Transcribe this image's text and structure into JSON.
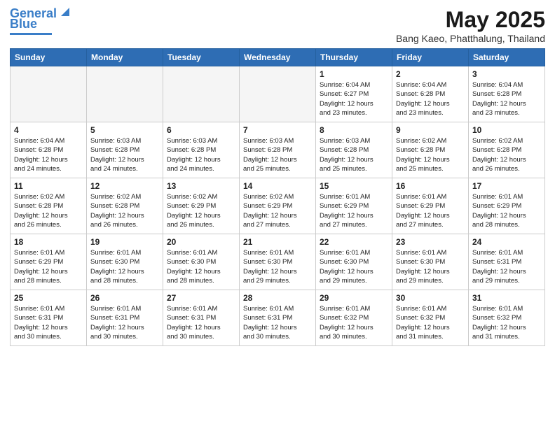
{
  "header": {
    "logo_line1": "General",
    "logo_line2": "Blue",
    "title": "May 2025",
    "subtitle": "Bang Kaeo, Phatthalung, Thailand"
  },
  "calendar": {
    "weekdays": [
      "Sunday",
      "Monday",
      "Tuesday",
      "Wednesday",
      "Thursday",
      "Friday",
      "Saturday"
    ],
    "weeks": [
      [
        {
          "day": "",
          "empty": true
        },
        {
          "day": "",
          "empty": true
        },
        {
          "day": "",
          "empty": true
        },
        {
          "day": "",
          "empty": true
        },
        {
          "day": "1",
          "info": "Sunrise: 6:04 AM\nSunset: 6:27 PM\nDaylight: 12 hours\nand 23 minutes."
        },
        {
          "day": "2",
          "info": "Sunrise: 6:04 AM\nSunset: 6:28 PM\nDaylight: 12 hours\nand 23 minutes."
        },
        {
          "day": "3",
          "info": "Sunrise: 6:04 AM\nSunset: 6:28 PM\nDaylight: 12 hours\nand 23 minutes."
        }
      ],
      [
        {
          "day": "4",
          "info": "Sunrise: 6:04 AM\nSunset: 6:28 PM\nDaylight: 12 hours\nand 24 minutes."
        },
        {
          "day": "5",
          "info": "Sunrise: 6:03 AM\nSunset: 6:28 PM\nDaylight: 12 hours\nand 24 minutes."
        },
        {
          "day": "6",
          "info": "Sunrise: 6:03 AM\nSunset: 6:28 PM\nDaylight: 12 hours\nand 24 minutes."
        },
        {
          "day": "7",
          "info": "Sunrise: 6:03 AM\nSunset: 6:28 PM\nDaylight: 12 hours\nand 25 minutes."
        },
        {
          "day": "8",
          "info": "Sunrise: 6:03 AM\nSunset: 6:28 PM\nDaylight: 12 hours\nand 25 minutes."
        },
        {
          "day": "9",
          "info": "Sunrise: 6:02 AM\nSunset: 6:28 PM\nDaylight: 12 hours\nand 25 minutes."
        },
        {
          "day": "10",
          "info": "Sunrise: 6:02 AM\nSunset: 6:28 PM\nDaylight: 12 hours\nand 26 minutes."
        }
      ],
      [
        {
          "day": "11",
          "info": "Sunrise: 6:02 AM\nSunset: 6:28 PM\nDaylight: 12 hours\nand 26 minutes."
        },
        {
          "day": "12",
          "info": "Sunrise: 6:02 AM\nSunset: 6:28 PM\nDaylight: 12 hours\nand 26 minutes."
        },
        {
          "day": "13",
          "info": "Sunrise: 6:02 AM\nSunset: 6:29 PM\nDaylight: 12 hours\nand 26 minutes."
        },
        {
          "day": "14",
          "info": "Sunrise: 6:02 AM\nSunset: 6:29 PM\nDaylight: 12 hours\nand 27 minutes."
        },
        {
          "day": "15",
          "info": "Sunrise: 6:01 AM\nSunset: 6:29 PM\nDaylight: 12 hours\nand 27 minutes."
        },
        {
          "day": "16",
          "info": "Sunrise: 6:01 AM\nSunset: 6:29 PM\nDaylight: 12 hours\nand 27 minutes."
        },
        {
          "day": "17",
          "info": "Sunrise: 6:01 AM\nSunset: 6:29 PM\nDaylight: 12 hours\nand 28 minutes."
        }
      ],
      [
        {
          "day": "18",
          "info": "Sunrise: 6:01 AM\nSunset: 6:29 PM\nDaylight: 12 hours\nand 28 minutes."
        },
        {
          "day": "19",
          "info": "Sunrise: 6:01 AM\nSunset: 6:30 PM\nDaylight: 12 hours\nand 28 minutes."
        },
        {
          "day": "20",
          "info": "Sunrise: 6:01 AM\nSunset: 6:30 PM\nDaylight: 12 hours\nand 28 minutes."
        },
        {
          "day": "21",
          "info": "Sunrise: 6:01 AM\nSunset: 6:30 PM\nDaylight: 12 hours\nand 29 minutes."
        },
        {
          "day": "22",
          "info": "Sunrise: 6:01 AM\nSunset: 6:30 PM\nDaylight: 12 hours\nand 29 minutes."
        },
        {
          "day": "23",
          "info": "Sunrise: 6:01 AM\nSunset: 6:30 PM\nDaylight: 12 hours\nand 29 minutes."
        },
        {
          "day": "24",
          "info": "Sunrise: 6:01 AM\nSunset: 6:31 PM\nDaylight: 12 hours\nand 29 minutes."
        }
      ],
      [
        {
          "day": "25",
          "info": "Sunrise: 6:01 AM\nSunset: 6:31 PM\nDaylight: 12 hours\nand 30 minutes."
        },
        {
          "day": "26",
          "info": "Sunrise: 6:01 AM\nSunset: 6:31 PM\nDaylight: 12 hours\nand 30 minutes."
        },
        {
          "day": "27",
          "info": "Sunrise: 6:01 AM\nSunset: 6:31 PM\nDaylight: 12 hours\nand 30 minutes."
        },
        {
          "day": "28",
          "info": "Sunrise: 6:01 AM\nSunset: 6:31 PM\nDaylight: 12 hours\nand 30 minutes."
        },
        {
          "day": "29",
          "info": "Sunrise: 6:01 AM\nSunset: 6:32 PM\nDaylight: 12 hours\nand 30 minutes."
        },
        {
          "day": "30",
          "info": "Sunrise: 6:01 AM\nSunset: 6:32 PM\nDaylight: 12 hours\nand 31 minutes."
        },
        {
          "day": "31",
          "info": "Sunrise: 6:01 AM\nSunset: 6:32 PM\nDaylight: 12 hours\nand 31 minutes."
        }
      ]
    ]
  }
}
